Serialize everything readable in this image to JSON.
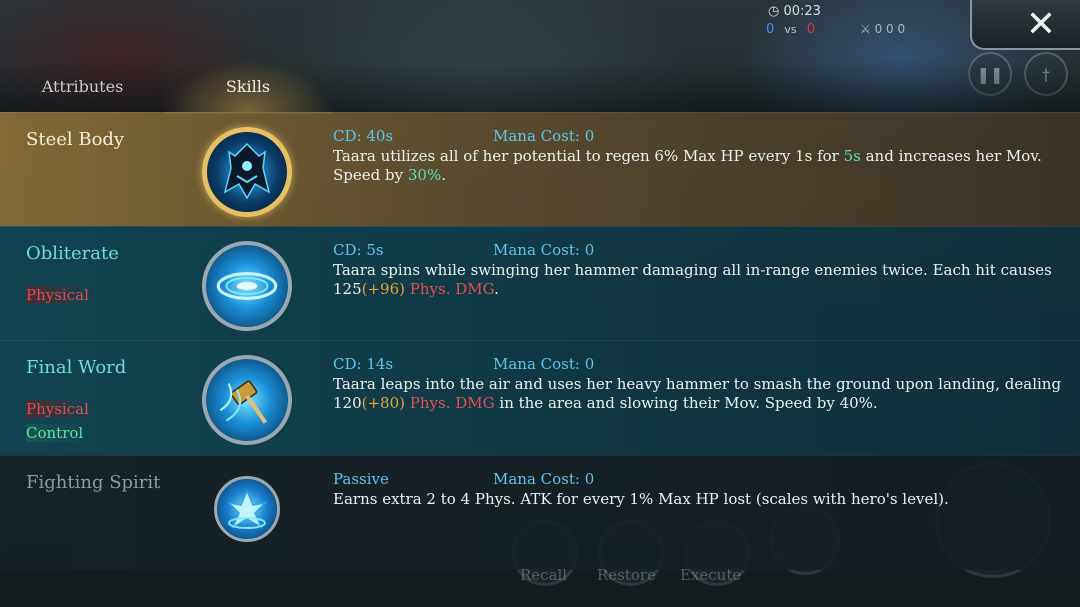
{
  "hud": {
    "timer": "00:23",
    "score_blue": "0",
    "score_vs": "vs",
    "score_red": "0",
    "kda": "0   0   0"
  },
  "tabs": [
    {
      "label": "Attributes",
      "active": false
    },
    {
      "label": "Skills",
      "active": true
    }
  ],
  "skills": [
    {
      "name": "Steel Body",
      "tags": [],
      "cd": "CD: 40s",
      "mana": "Mana Cost: 0",
      "desc": [
        {
          "text": "Taara utilizes all of her potential to regen 6% Max HP every 1s for ",
          "style": "plain"
        },
        {
          "text": "5s",
          "style": "green"
        },
        {
          "text": " and increases her Mov. Speed by ",
          "style": "plain"
        },
        {
          "text": "30%",
          "style": "green"
        },
        {
          "text": ".",
          "style": "plain"
        }
      ],
      "icon": "armored-hero-icon"
    },
    {
      "name": "Obliterate",
      "tags": [
        {
          "label": "Physical",
          "kind": "phys"
        }
      ],
      "cd": "CD: 5s",
      "mana": "Mana Cost: 0",
      "desc": [
        {
          "text": "Taara spins while swinging her hammer damaging all in-range enemies twice. Each hit causes 125",
          "style": "plain"
        },
        {
          "text": "(+96)",
          "style": "orange"
        },
        {
          "text": " ",
          "style": "plain"
        },
        {
          "text": "Phys. DMG",
          "style": "red"
        },
        {
          "text": ".",
          "style": "plain"
        }
      ],
      "icon": "spin-vortex-icon"
    },
    {
      "name": "Final Word",
      "tags": [
        {
          "label": "Physical",
          "kind": "phys"
        },
        {
          "label": "Control",
          "kind": "ctrl"
        }
      ],
      "cd": "CD: 14s",
      "mana": "Mana Cost: 0",
      "desc": [
        {
          "text": "Taara leaps into the air and uses her heavy hammer to smash the ground upon landing, dealing 120",
          "style": "plain"
        },
        {
          "text": "(+80)",
          "style": "orange"
        },
        {
          "text": " ",
          "style": "plain"
        },
        {
          "text": "Phys. DMG",
          "style": "red"
        },
        {
          "text": " in the area and slowing their Mov. Speed by 40%.",
          "style": "plain"
        }
      ],
      "icon": "hammer-smash-icon"
    },
    {
      "name": "Fighting Spirit",
      "tags": [],
      "cd": "Passive",
      "mana": "Mana Cost: 0",
      "desc": [
        {
          "text": "Earns extra 2 to 4 Phys. ATK for every 1% Max HP lost (scales with hero's level).",
          "style": "plain"
        }
      ],
      "icon": "crystal-burst-icon"
    }
  ],
  "background_buttons": {
    "recall": "Recall",
    "restore": "Restore",
    "execute": "Execute"
  }
}
